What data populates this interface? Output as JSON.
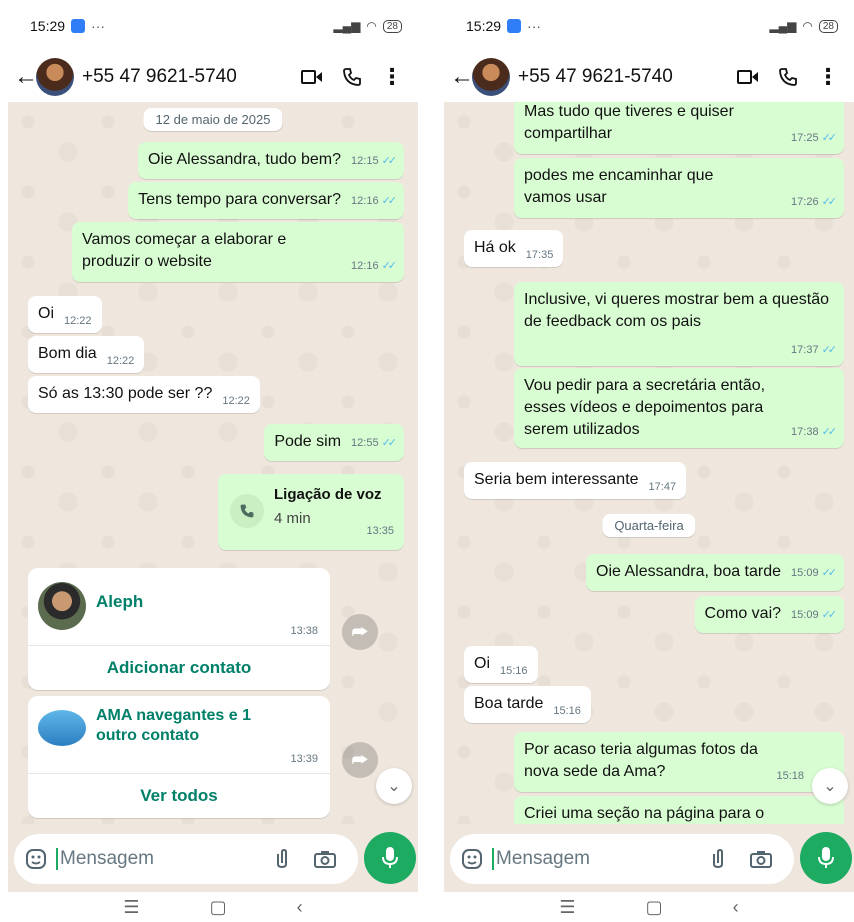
{
  "phone1": {
    "status": {
      "time": "15:29",
      "dots": "···",
      "battery": "28"
    },
    "header": {
      "phone": "+55 47 9621-5740"
    },
    "date_chip": "12 de maio de 2025",
    "messages": [
      {
        "text": "Oie Alessandra, tudo bem?",
        "time": "12:15"
      },
      {
        "text": "Tens tempo para conversar?",
        "time": "12:16"
      },
      {
        "text": "Vamos começar a elaborar e produzir o website",
        "time": "12:16"
      },
      {
        "text": "Oi",
        "time": "12:22"
      },
      {
        "text": "Bom dia",
        "time": "12:22"
      },
      {
        "text": "Só as 13:30 pode ser ??",
        "time": "12:22"
      },
      {
        "text": "Pode sim",
        "time": "12:55"
      }
    ],
    "call": {
      "title": "Ligação de voz",
      "duration": "4 min",
      "time": "13:35"
    },
    "contact1": {
      "name": "Aleph",
      "time": "13:38",
      "action": "Adicionar contato"
    },
    "contact2": {
      "name": "AMA navegantes  e 1 outro contato",
      "time": "13:39",
      "action": "Ver todos"
    },
    "composer": {
      "placeholder": "Mensagem"
    }
  },
  "phone2": {
    "status": {
      "time": "15:29",
      "dots": "···",
      "battery": "28"
    },
    "header": {
      "phone": "+55 47 9621-5740"
    },
    "messages": [
      {
        "text": "Mas tudo que tiveres e quiser compartilhar",
        "time": "17:25"
      },
      {
        "text": "podes me encaminhar que vamos usar",
        "time": "17:26"
      },
      {
        "text": "Há ok",
        "time": "17:35"
      },
      {
        "text": "Inclusive, vi queres mostrar bem a questão de feedback com os pais",
        "time": "17:37"
      },
      {
        "text": "Vou pedir para a secretária então, esses vídeos e depoimentos para serem utilizados",
        "time": "17:38"
      },
      {
        "text": "Seria bem interessante",
        "time": "17:47"
      },
      {
        "text": "Oie Alessandra, boa tarde",
        "time": "15:09"
      },
      {
        "text": "Como vai?",
        "time": "15:09"
      },
      {
        "text": "Oi",
        "time": "15:16"
      },
      {
        "text": "Boa tarde",
        "time": "15:16"
      },
      {
        "text": "Por acaso teria algumas fotos da nova sede da Ama?",
        "time": "15:18"
      },
      {
        "text": "Criei uma seção na página para o",
        "time": ""
      }
    ],
    "date_chip": "Quarta-feira",
    "composer": {
      "placeholder": "Mensagem"
    }
  },
  "icons": [
    "back-arrow-icon",
    "video-call-icon",
    "phone-icon",
    "more-icon",
    "emoji-icon",
    "attach-icon",
    "camera-icon",
    "mic-icon",
    "forward-icon",
    "scroll-down-icon",
    "double-check-icon"
  ],
  "colors": {
    "out_bubble": "#d9fdd3",
    "in_bubble": "#ffffff",
    "accent": "#1daa61",
    "link_green": "#008069",
    "chat_bg": "#efe7dd"
  }
}
